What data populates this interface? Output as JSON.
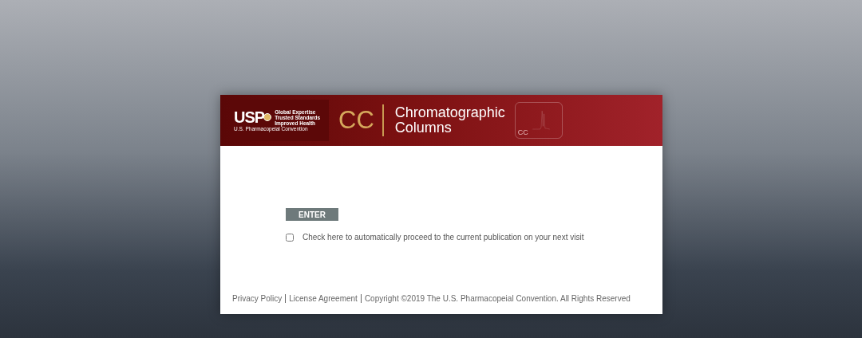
{
  "header": {
    "logo": {
      "mark": "USP",
      "org": "U.S. Pharmacopeial Convention",
      "tagline": [
        "Global Expertise",
        "Trusted Standards",
        "Improved Health"
      ]
    },
    "product_code": "CC",
    "product_name": [
      "Chromatographic",
      "Columns"
    ],
    "badge_label": "CC"
  },
  "enter_button": "ENTER",
  "auto_proceed": {
    "label": "Check here to automatically proceed to the current publication on your next visit",
    "checked": false
  },
  "footer": {
    "links": [
      "Privacy Policy",
      "License Agreement"
    ],
    "copyright": "Copyright ©2019 The U.S. Pharmacopeial Convention. All Rights Reserved"
  }
}
